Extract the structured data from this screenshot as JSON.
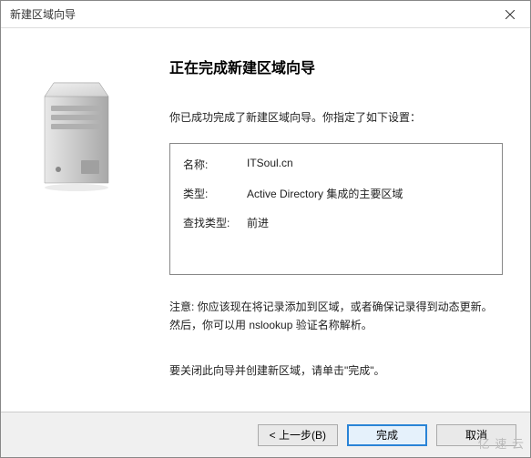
{
  "window": {
    "title": "新建区域向导"
  },
  "header": {
    "heading": "正在完成新建区域向导"
  },
  "body": {
    "success_text": "你已成功完成了新建区域向导。你指定了如下设置：",
    "summary": {
      "name_label": "名称:",
      "name_value": "ITSoul.cn",
      "type_label": "类型:",
      "type_value": "Active Directory 集成的主要区域",
      "lookup_label": "查找类型:",
      "lookup_value": "前进"
    },
    "note": "注意: 你应该现在将记录添加到区域，或者确保记录得到动态更新。然后，你可以用 nslookup 验证名称解析。",
    "instruction": "要关闭此向导并创建新区域，请单击\"完成\"。"
  },
  "footer": {
    "back": "< 上一步(B)",
    "finish": "完成",
    "cancel": "取消"
  },
  "watermark": "亿 速 云"
}
